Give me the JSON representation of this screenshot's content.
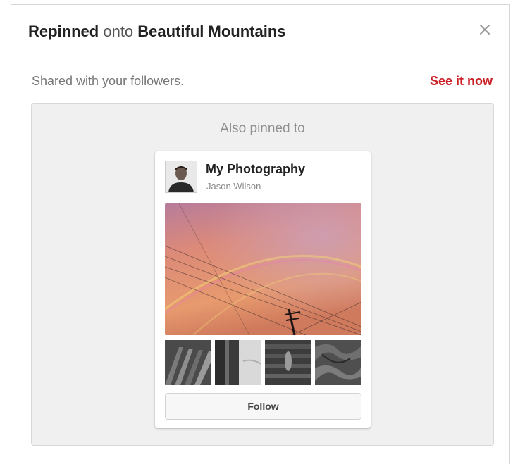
{
  "modal": {
    "title_bold_1": "Repinned",
    "title_light": " onto ",
    "title_bold_2": "Beautiful Mountains",
    "close_icon": "close-icon"
  },
  "shared": {
    "message": "Shared with your followers.",
    "link_label": "See it now",
    "link_color": "#cb2027"
  },
  "panel": {
    "heading": "Also pinned to",
    "board": {
      "name": "My Photography",
      "owner": "Jason Wilson",
      "follow_label": "Follow"
    }
  }
}
